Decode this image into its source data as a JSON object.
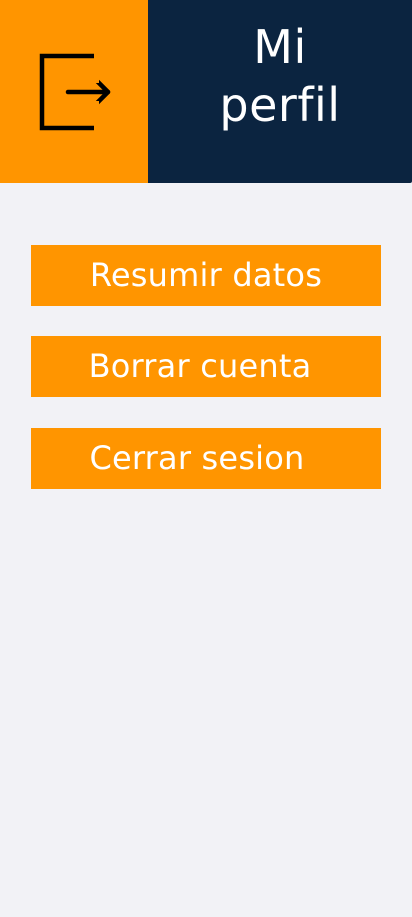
{
  "header": {
    "title": "Mi\nperfil",
    "logout_icon": "logout-icon",
    "accent_color": "#ff9500",
    "title_bg_color": "#0b2440"
  },
  "menu": {
    "items": [
      {
        "label": "Resumir datos"
      },
      {
        "label": "Borrar cuenta"
      },
      {
        "label": "Cerrar sesion"
      }
    ]
  },
  "background_color": "#f2f2f6"
}
